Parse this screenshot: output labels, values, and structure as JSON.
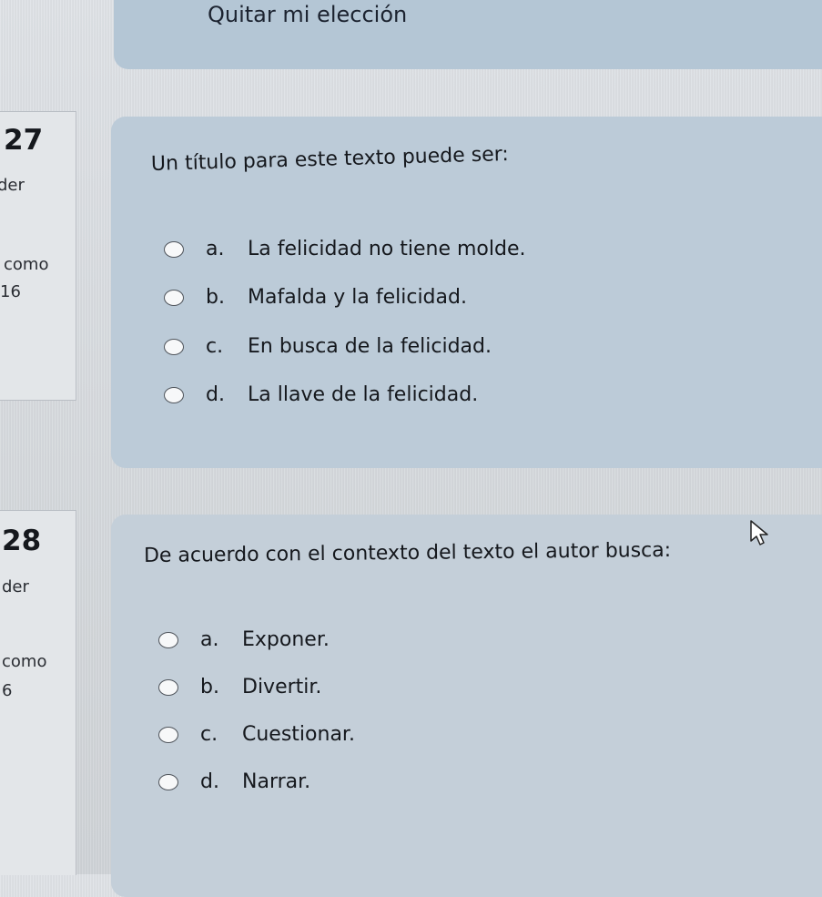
{
  "top": {
    "clear_choice": "Quitar mi elección"
  },
  "questions": [
    {
      "number": "27",
      "side_lines": [
        "der",
        "como",
        "16"
      ],
      "prompt": "Un título para este texto puede ser:",
      "options": [
        {
          "letter": "a.",
          "text": "La felicidad no tiene molde."
        },
        {
          "letter": "b.",
          "text": "Mafalda y la felicidad."
        },
        {
          "letter": "c.",
          "text": "En busca de la felicidad."
        },
        {
          "letter": "d.",
          "text": "La llave de la felicidad."
        }
      ]
    },
    {
      "number": "28",
      "side_lines": [
        "der",
        "como",
        "6"
      ],
      "prompt": "De acuerdo con el contexto del texto el autor busca:",
      "options": [
        {
          "letter": "a.",
          "text": "Exponer."
        },
        {
          "letter": "b.",
          "text": "Divertir."
        },
        {
          "letter": "c.",
          "text": "Cuestionar."
        },
        {
          "letter": "d.",
          "text": "Narrar."
        }
      ]
    }
  ],
  "icons": {
    "cursor": "mouse-pointer-icon",
    "radio": "radio-unselected-icon"
  }
}
